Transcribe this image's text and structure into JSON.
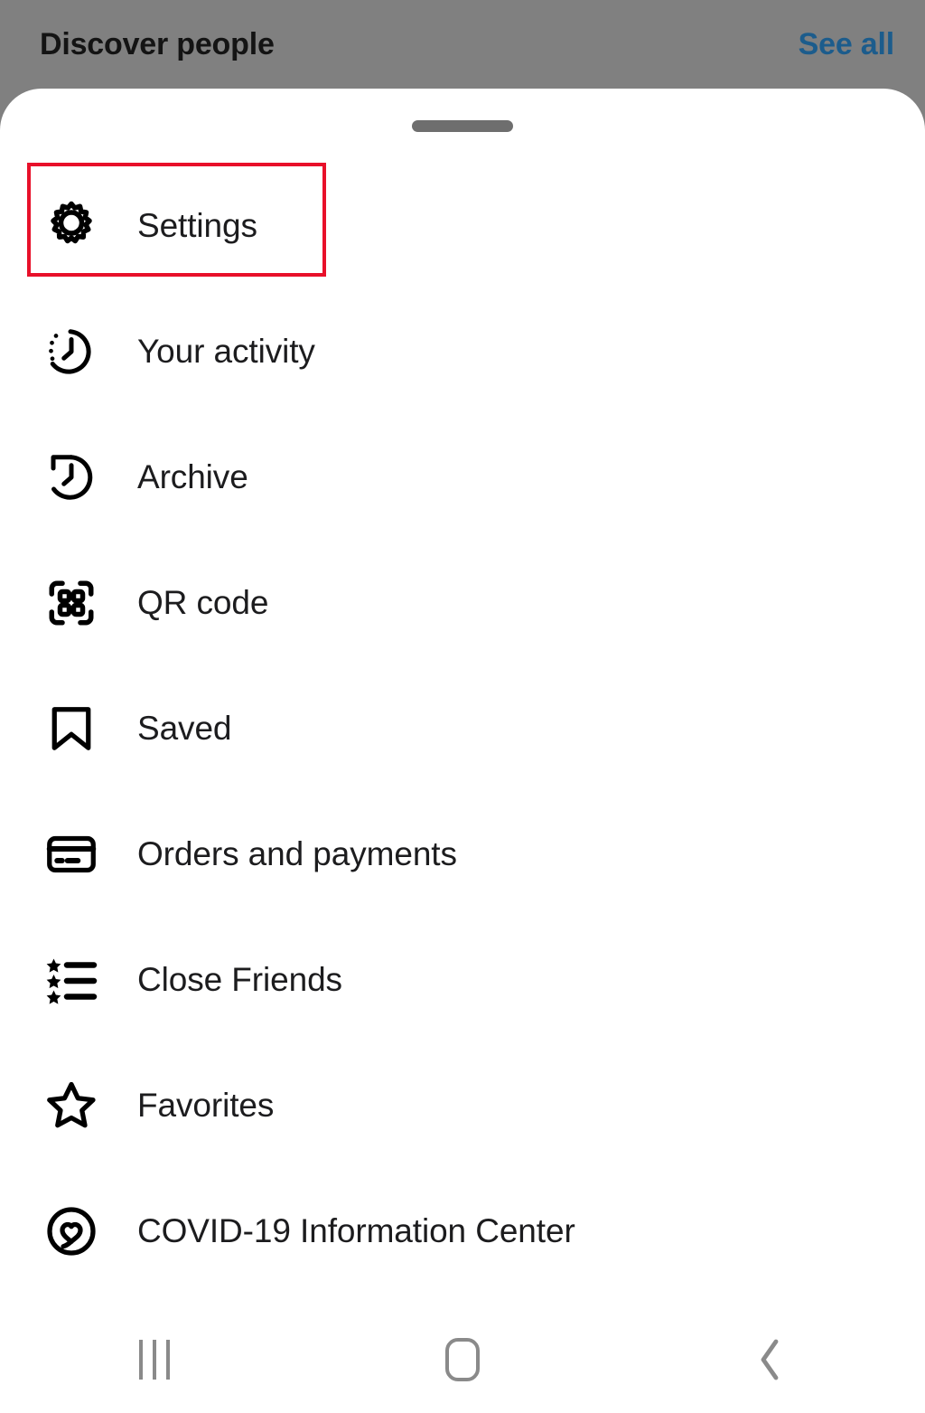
{
  "background": {
    "section_title": "Discover people",
    "see_all_label": "See all",
    "scrim_color": "#808080",
    "link_color": "#1c5c8c"
  },
  "sheet": {
    "handle_name": "drag-handle",
    "background_color": "#ffffff"
  },
  "highlight": {
    "target": "Settings",
    "color": "#e8102a"
  },
  "menu": {
    "items": [
      {
        "label": "Settings",
        "icon": "gear-icon"
      },
      {
        "label": "Your activity",
        "icon": "clock-activity-icon"
      },
      {
        "label": "Archive",
        "icon": "clock-history-icon"
      },
      {
        "label": "QR code",
        "icon": "qr-code-icon"
      },
      {
        "label": "Saved",
        "icon": "bookmark-icon"
      },
      {
        "label": "Orders and payments",
        "icon": "credit-card-icon"
      },
      {
        "label": "Close Friends",
        "icon": "star-list-icon"
      },
      {
        "label": "Favorites",
        "icon": "star-outline-icon"
      },
      {
        "label": "COVID-19 Information Center",
        "icon": "heart-circle-icon"
      }
    ]
  },
  "navbar": {
    "recents_label": "Recents",
    "home_label": "Home",
    "back_label": "Back",
    "icon_color": "#8a8a8a"
  }
}
